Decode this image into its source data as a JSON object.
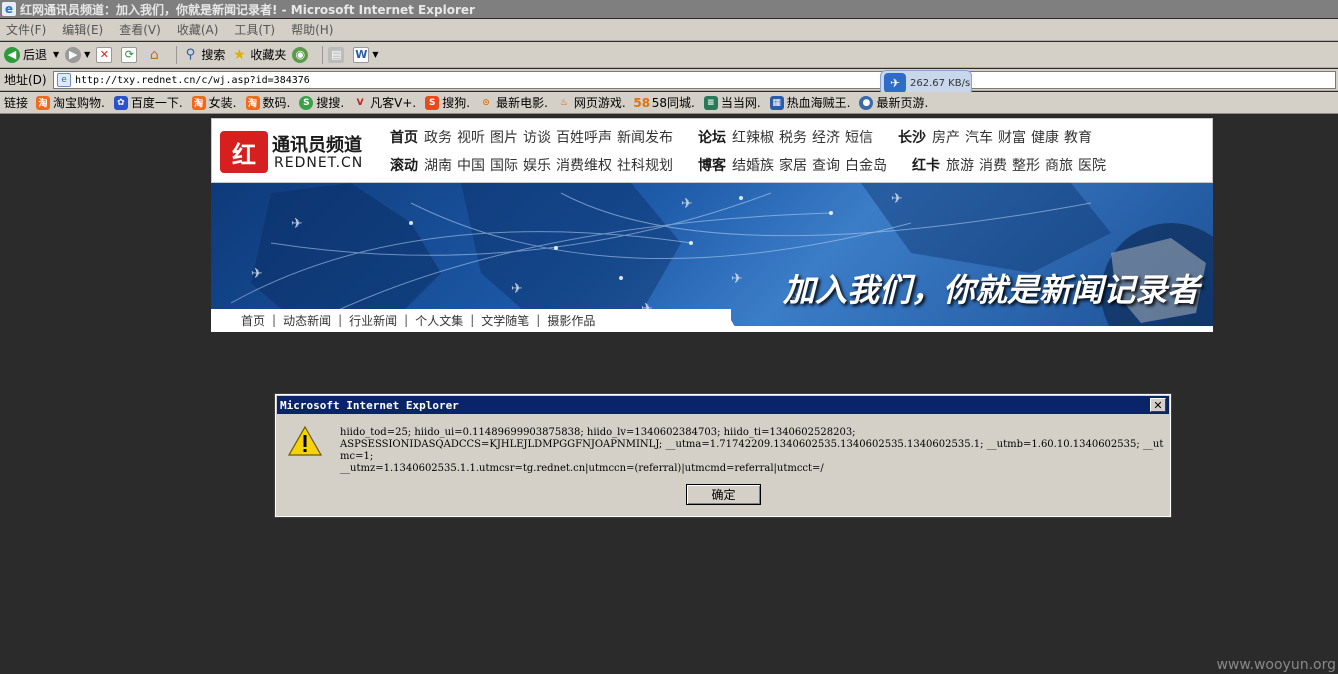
{
  "window": {
    "title": "红网通讯员频道：加入我们，你就是新闻记录者! - Microsoft Internet Explorer"
  },
  "menu": [
    "文件(F)",
    "编辑(E)",
    "查看(V)",
    "收藏(A)",
    "工具(T)",
    "帮助(H)"
  ],
  "toolbar": {
    "back_label": "后退",
    "search_label": "搜索",
    "favorites_label": "收藏夹"
  },
  "address": {
    "label": "地址(D)",
    "url": "http://txy.rednet.cn/c/wj.asp?id=384376"
  },
  "speed": {
    "value": "262.67 KB/s"
  },
  "links": {
    "label": "链接",
    "items": [
      "淘宝购物.",
      "百度一下.",
      "女装.",
      "数码.",
      "搜搜.",
      "凡客V+.",
      "搜狗.",
      "最新电影.",
      "网页游戏.",
      "58同城.",
      "当当网.",
      "热血海贼王.",
      "最新页游."
    ]
  },
  "site": {
    "logo_title": "通讯员频道",
    "logo_sub": "REDNET.CN",
    "logo_mark": "红",
    "nav_row1": [
      {
        "head": "首页",
        "items": [
          "政务",
          "视听",
          "图片",
          "访谈",
          "百姓呼声",
          "新闻发布"
        ]
      },
      {
        "head": "论坛",
        "items": [
          "红辣椒",
          "税务",
          "经济",
          "短信"
        ]
      },
      {
        "head": "长沙",
        "items": [
          "房产",
          "汽车",
          "财富",
          "健康",
          "教育"
        ]
      }
    ],
    "nav_row2": [
      {
        "head": "滚动",
        "items": [
          "湖南",
          "中国",
          "国际",
          "娱乐",
          "消费维权",
          "社科规划"
        ]
      },
      {
        "head": "博客",
        "items": [
          "结婚族",
          "家居",
          "查询",
          "白金岛"
        ]
      },
      {
        "head": "红卡",
        "items": [
          "旅游",
          "消费",
          "整形",
          "商旅",
          "医院"
        ]
      }
    ],
    "banner_text": "加入我们，你就是新闻记录者",
    "subnav": [
      "首页",
      "动态新闻",
      "行业新闻",
      "个人文集",
      "文学随笔",
      "摄影作品"
    ]
  },
  "dialog": {
    "title": "Microsoft Internet Explorer",
    "message": "hiido_tod=25; hiido_ui=0.11489699903875838; hiido_lv=1340602384703; hiido_ti=1340602528203;\nASPSESSIONIDASQADCCS=KJHLEJLDMPGGFNJOAPNMINLJ; __utma=1.71742209.1340602535.1340602535.1340602535.1; __utmb=1.60.10.1340602535; __utmc=1;\n__utmz=1.1340602535.1.1.utmcsr=tg.rednet.cn|utmccn=(referral)|utmcmd=referral|utmcct=/",
    "ok_label": "确定"
  },
  "watermark": "www.wooyun.org"
}
